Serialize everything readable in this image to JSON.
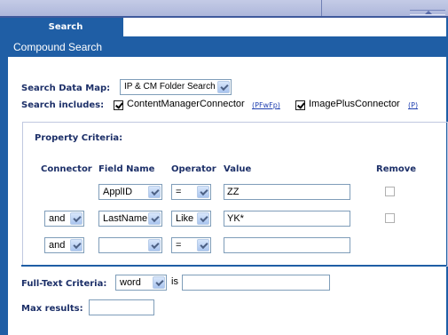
{
  "tabs": [
    {
      "label": "Search",
      "active": true
    }
  ],
  "section_title": "Compound Search",
  "search_data_map": {
    "label": "Search Data Map:",
    "value": "IP & CM Folder Search"
  },
  "search_includes": {
    "label": "Search includes:",
    "connectors": [
      {
        "name": "ContentManagerConnector",
        "code": "(PFwFp)",
        "checked": true
      },
      {
        "name": "ImagePlusConnector",
        "code": "(P)",
        "checked": true
      }
    ]
  },
  "property_criteria": {
    "title": "Property Criteria:",
    "headers": {
      "connector": "Connector",
      "field": "Field Name",
      "operator": "Operator",
      "value": "Value",
      "remove": "Remove"
    },
    "rows": [
      {
        "connector": "",
        "field": "ApplID",
        "operator": "=",
        "value": "ZZ",
        "removable": true
      },
      {
        "connector": "and",
        "field": "LastName",
        "operator": "Like",
        "value": "YK*",
        "removable": true
      },
      {
        "connector": "and",
        "field": "",
        "operator": "=",
        "value": "",
        "removable": false
      }
    ]
  },
  "full_text": {
    "label": "Full-Text Criteria:",
    "mode": "word",
    "is_label": "is",
    "value": ""
  },
  "max_results": {
    "label": "Max results:",
    "value": ""
  },
  "colors": {
    "brand_blue": "#1f5ea5",
    "label_navy": "#1c2f68"
  }
}
